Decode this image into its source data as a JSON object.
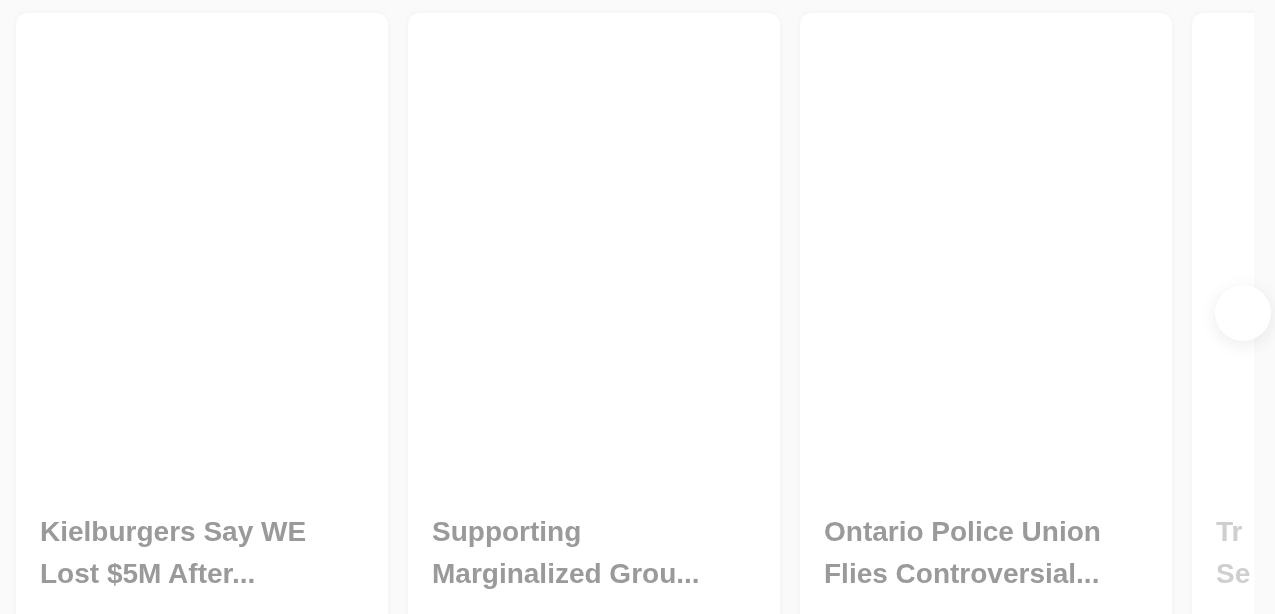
{
  "cards": [
    {
      "title_lines": [
        "Kielburgers Say WE",
        "Lost $5M After..."
      ],
      "faded": false
    },
    {
      "title_lines": [
        "Supporting",
        "Marginalized Grou..."
      ],
      "faded": false
    },
    {
      "title_lines": [
        "Ontario Police Union",
        "Flies Controversial..."
      ],
      "faded": false
    },
    {
      "title_lines": [
        "Tr",
        "Se"
      ],
      "faded": true
    }
  ]
}
